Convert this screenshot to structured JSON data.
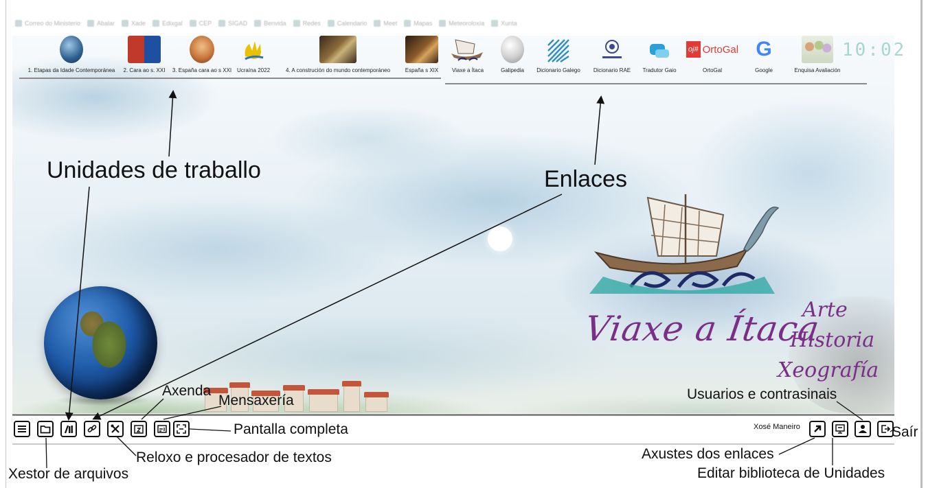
{
  "bookmarks": [
    "Correo do Ministerio",
    "Abalar",
    "Xade",
    "Edixgal",
    "CEP",
    "SIGAD",
    "Benvida",
    "Redes",
    "Calendario",
    "Meet",
    "Mapas",
    "Meteoroloxía",
    "Xunta"
  ],
  "units": [
    {
      "label": "1. Etapas da Idade Contemporánea",
      "icon": "globe-thumb-icon",
      "color": "#3f6d8f"
    },
    {
      "label": "2. Cara ao s. XXI",
      "icon": "flags-thumb-icon",
      "color": "#c0392b"
    },
    {
      "label": "3. España cara ao s XXI",
      "icon": "portrait-thumb-icon",
      "color": "#c8783c"
    },
    {
      "label": "Ucraína 2022",
      "icon": "hand-thumb-icon",
      "color": "#e8c100"
    },
    {
      "label": "4. A construción do mundo contemporáneo",
      "icon": "painting-thumb-icon",
      "color": "#6b4a2e"
    },
    {
      "label": "España s XIX",
      "icon": "battle-thumb-icon",
      "color": "#8a5a2a"
    }
  ],
  "links": [
    {
      "label": "Viaxe a Ítaca",
      "icon": "ship-thumb-icon",
      "color": "#7f8f94"
    },
    {
      "label": "Galipedia",
      "icon": "wiki-globe-icon",
      "color": "#9a9a9a"
    },
    {
      "label": "Dicionario Galego",
      "icon": "dictionary-logo-icon",
      "color": "#2f8fc4"
    },
    {
      "label": "Dicionario RAE",
      "icon": "rae-crest-icon",
      "color": "#3b4a8a"
    },
    {
      "label": "Tradutor Gaio",
      "icon": "translator-logo-icon",
      "color": "#2aa0d8"
    },
    {
      "label": "OrtoGal",
      "icon": "ortogal-logo-icon",
      "color": "#e53935",
      "badge": "OrtoGal"
    },
    {
      "label": "Google",
      "icon": "google-logo-icon",
      "color": "#4285f4",
      "badge": "G"
    },
    {
      "label": "Enquisa Avaliación",
      "icon": "survey-people-icon",
      "color": "#9bb08a"
    }
  ],
  "clock": "10:02",
  "brand": {
    "title": "Viaxe a Ítaca",
    "line1": "Arte",
    "line2": "Historia",
    "line3": "Xeografía"
  },
  "user": {
    "name": "Xosé Maneiro"
  },
  "annotations": {
    "units": "Unidades de traballo",
    "links": "Enlaces",
    "calendar": "Axenda",
    "messaging": "Mensaxería",
    "fullscreen": "Pantalla completa",
    "clock_editor": "Reloxo e procesador de textos",
    "files": "Xestor de arquivos",
    "users": "Usuarios e contrasinais",
    "exit": "Saír",
    "link_settings": "Axustes dos enlaces",
    "edit_library": "Editar biblioteca de Unidades"
  },
  "toolbar": {
    "left": [
      "menu-icon",
      "folder-icon",
      "books-icon",
      "link-icon",
      "tools-icon",
      "calendar-icon",
      "message-icon",
      "fullscreen-icon"
    ],
    "right": [
      "link-settings-icon",
      "library-edit-icon",
      "user-icon",
      "logout-icon"
    ]
  },
  "colors": {
    "brand_purple": "#7a2f86",
    "toolbar_rule": "#888888",
    "sky": "#dde9f0"
  }
}
